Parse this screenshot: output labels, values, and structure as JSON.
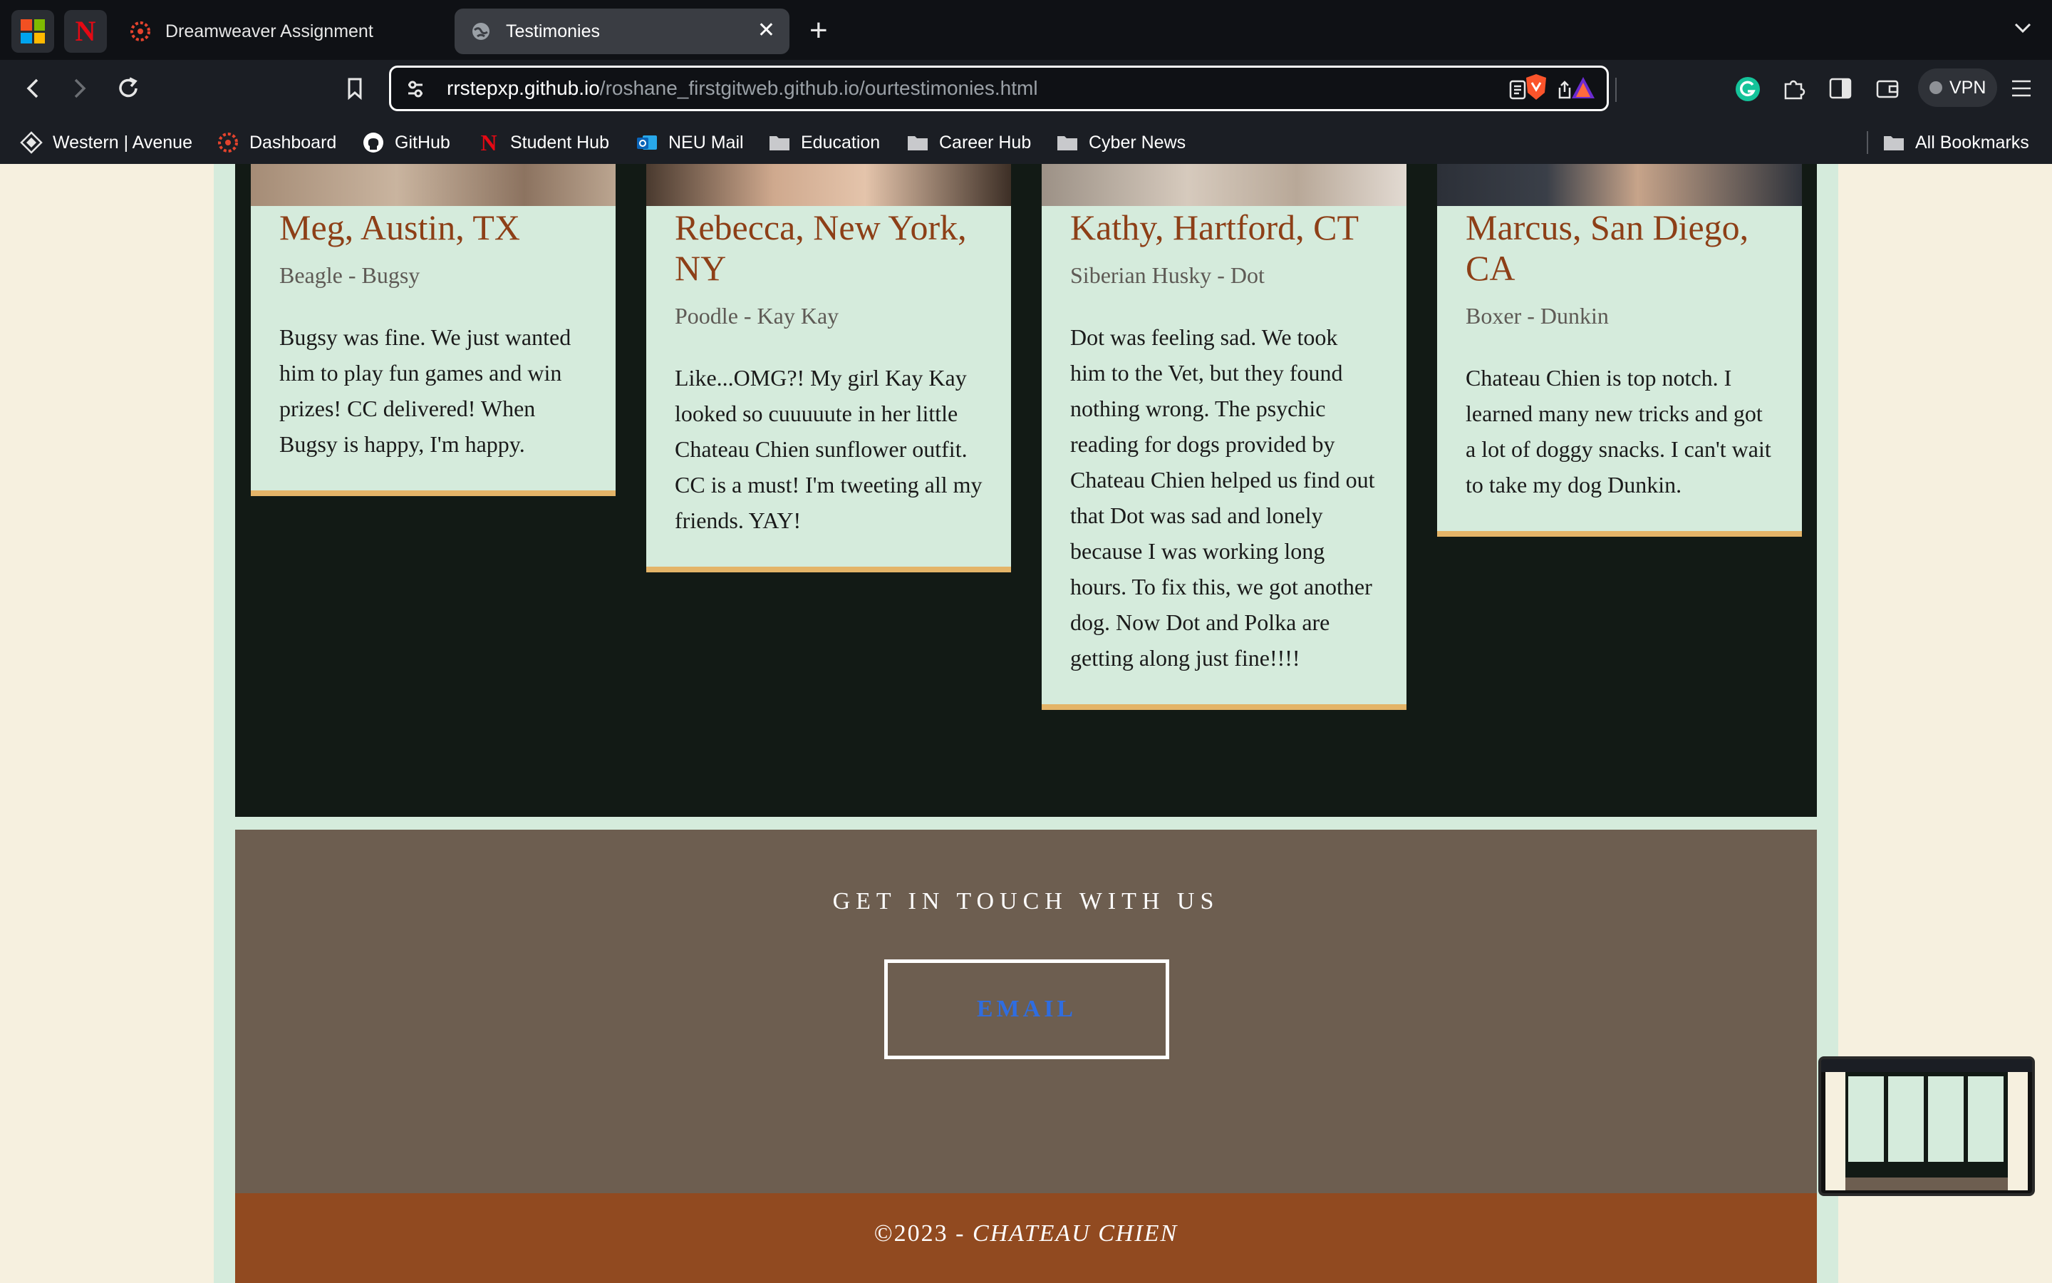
{
  "browser": {
    "tabs": [
      {
        "label": "Dreamweaver Assignment",
        "active": false
      },
      {
        "label": "Testimonies",
        "active": true
      }
    ],
    "url": {
      "host": "rrstepxp.github.io",
      "path": "/roshane_firstgitweb.github.io/ourtestimonies.html"
    },
    "vpn_label": "VPN",
    "bookmarks": [
      "Western | Avenue",
      "Dashboard",
      "GitHub",
      "Student Hub",
      "NEU Mail",
      "Education",
      "Career Hub",
      "Cyber News"
    ],
    "all_bookmarks_label": "All Bookmarks"
  },
  "testimonials": [
    {
      "name": "Meg, Austin, TX",
      "breed": "Beagle - Bugsy",
      "quote": "Bugsy was fine. We just wanted him to play fun games and win prizes! CC delivered! When Bugsy is happy, I'm happy."
    },
    {
      "name": "Rebecca, New York, NY",
      "breed": "Poodle - Kay Kay",
      "quote": "Like...OMG?! My girl Kay Kay looked so cuuuuute in her little Chateau Chien sunflower outfit. CC is a must! I'm tweeting all my friends. YAY!"
    },
    {
      "name": "Kathy, Hartford, CT",
      "breed": "Siberian Husky - Dot",
      "quote": "Dot was feeling sad. We took him to the Vet, but they found nothing wrong. The psychic reading for dogs provided by Chateau Chien helped us find out that Dot was sad and lonely because I was working long hours. To fix this, we got another dog. Now Dot and Polka are getting along just fine!!!!"
    },
    {
      "name": "Marcus, San Diego, CA",
      "breed": "Boxer - Dunkin",
      "quote": "Chateau Chien is top notch. I learned many new tricks and got a lot of doggy snacks. I can't wait to take my dog Dunkin."
    }
  ],
  "contact": {
    "heading": "GET IN TOUCH WITH US",
    "email_button": "EMAIL"
  },
  "footer": {
    "copyright": "©2023 - ",
    "brand": "CHATEAU CHIEN"
  },
  "colors": {
    "accent": "#8d3f17",
    "card_bg": "#d5ebdc",
    "card_border": "#e4b468",
    "dark_bg": "#121a15",
    "contact_bg": "#6d5e50",
    "footer_bg": "#914a20"
  }
}
